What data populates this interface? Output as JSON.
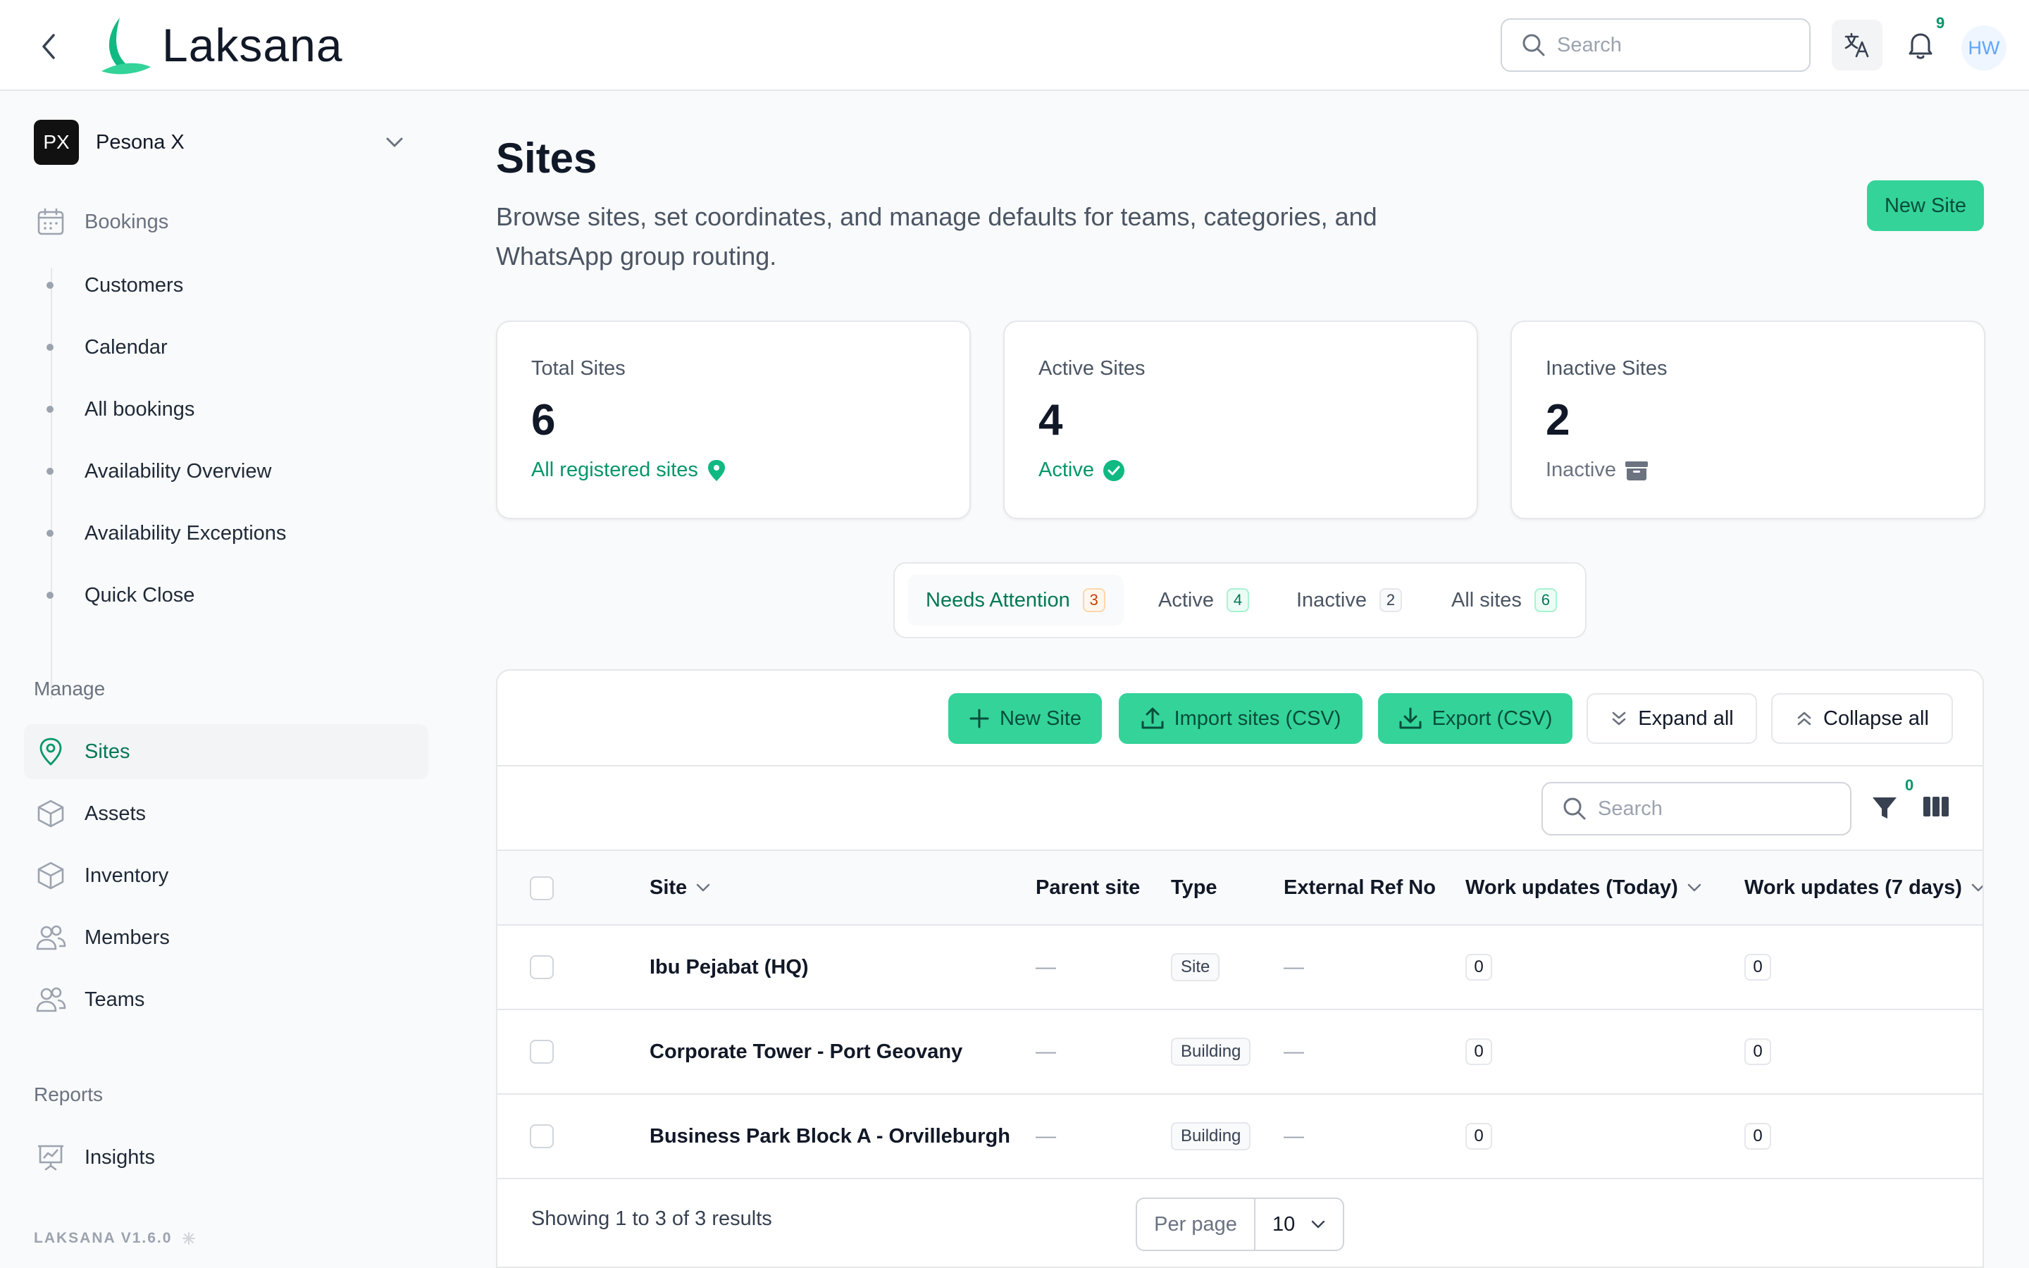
{
  "header": {
    "app_name": "Laksana",
    "search_placeholder": "Search",
    "notification_count": "9",
    "user_initials": "HW"
  },
  "sidebar": {
    "org_initials": "PX",
    "org_name": "Pesona X",
    "bookings_label": "Bookings",
    "booking_items": [
      "Customers",
      "Calendar",
      "All bookings",
      "Availability Overview",
      "Availability Exceptions",
      "Quick Close"
    ],
    "manage_label": "Manage",
    "manage_items": [
      "Sites",
      "Assets",
      "Inventory",
      "Members",
      "Teams"
    ],
    "reports_label": "Reports",
    "reports_items": [
      "Insights"
    ],
    "version": "LAKSANA V1.6.0"
  },
  "page": {
    "title": "Sites",
    "description": "Browse sites, set coordinates, and manage defaults for teams, categories, and WhatsApp group routing.",
    "new_site_label": "New Site"
  },
  "stats": [
    {
      "title": "Total Sites",
      "value": "6",
      "subtitle": "All registered sites"
    },
    {
      "title": "Active Sites",
      "value": "4",
      "subtitle": "Active"
    },
    {
      "title": "Inactive Sites",
      "value": "2",
      "subtitle": "Inactive"
    }
  ],
  "tabs": [
    {
      "label": "Needs Attention",
      "count": "3"
    },
    {
      "label": "Active",
      "count": "4"
    },
    {
      "label": "Inactive",
      "count": "2"
    },
    {
      "label": "All sites",
      "count": "6"
    }
  ],
  "toolbar": {
    "new_site": "New Site",
    "import": "Import sites (CSV)",
    "export": "Export (CSV)",
    "expand": "Expand all",
    "collapse": "Collapse all",
    "search_placeholder": "Search",
    "filter_count": "0"
  },
  "table": {
    "columns": [
      "Site",
      "Parent site",
      "Type",
      "External Ref No",
      "Work updates (Today)",
      "Work updates (7 days)"
    ],
    "rows": [
      {
        "site": "Ibu Pejabat (HQ)",
        "parent": "—",
        "type": "Site",
        "ref": "—",
        "today": "0",
        "week": "0"
      },
      {
        "site": "Corporate Tower - Port Geovany",
        "parent": "—",
        "type": "Building",
        "ref": "—",
        "today": "0",
        "week": "0"
      },
      {
        "site": "Business Park Block A - Orvilleburgh",
        "parent": "—",
        "type": "Building",
        "ref": "—",
        "today": "0",
        "week": "0"
      }
    ],
    "showing": "Showing 1 to 3 of 3 results",
    "per_page_label": "Per page",
    "per_page_value": "10"
  },
  "colors": {
    "accent": "#34d399",
    "accent_text": "#047857",
    "warning": "#c2410c"
  }
}
